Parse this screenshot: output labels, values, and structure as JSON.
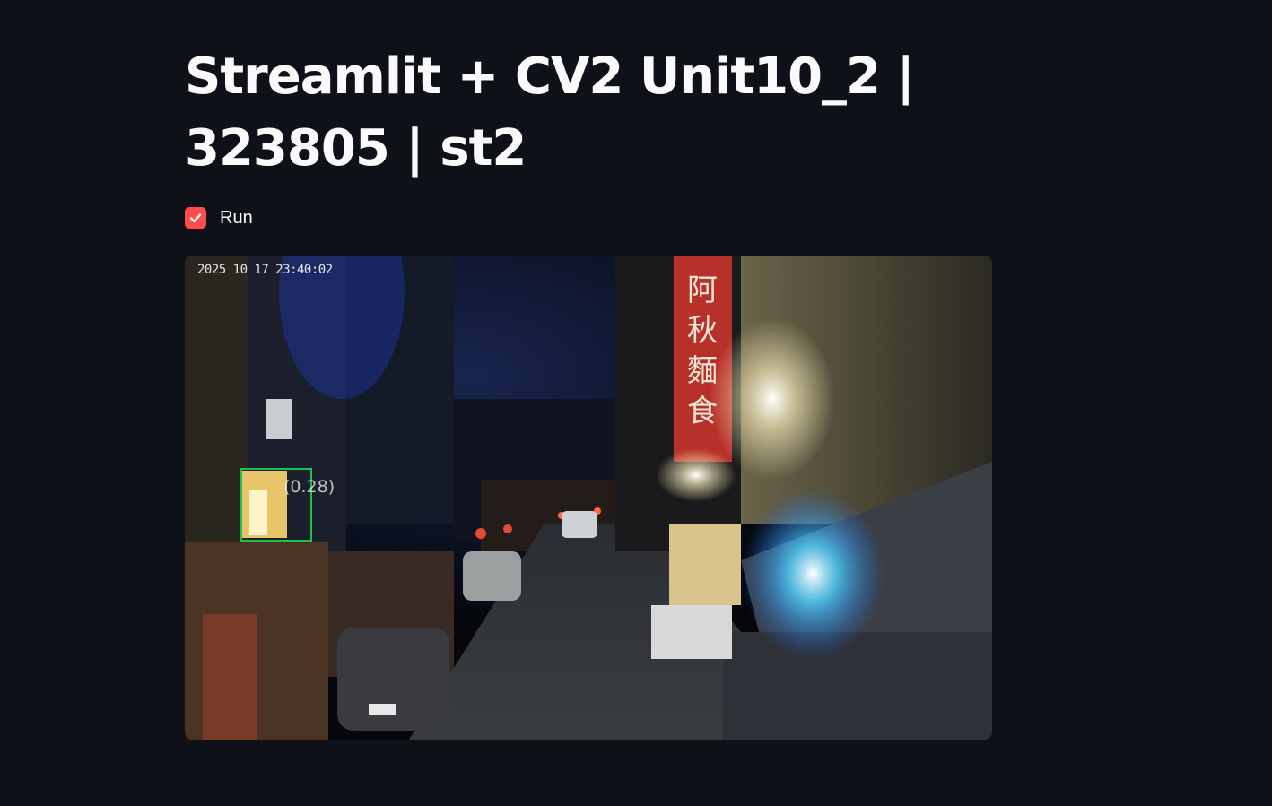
{
  "page": {
    "title": "Streamlit + CV2 Unit10_2 | 323805 | st2"
  },
  "run_checkbox": {
    "label": "Run",
    "checked": true,
    "accent_color": "#ff4b4b"
  },
  "video_frame": {
    "timestamp": "2025 10 17 23:40:02",
    "detection": {
      "label": "(0.28)",
      "box_color": "#1fbf4a"
    },
    "signboard_text": [
      "阿",
      "秋",
      "麵",
      "食"
    ]
  }
}
